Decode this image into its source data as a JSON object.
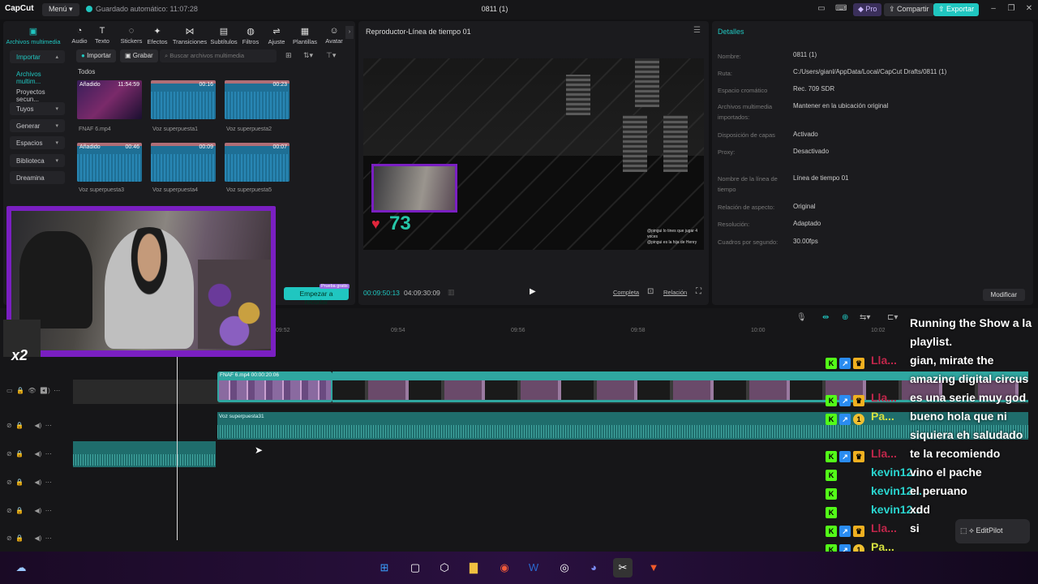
{
  "titlebar": {
    "logo": "CapCut",
    "menu": "Menú",
    "autosave": "Guardado automático: 11:07:28",
    "project": "0811 (1)",
    "pro": "Pro",
    "share": "Compartir",
    "export": "Exportar"
  },
  "tools": [
    {
      "label": "Archivos multimedia",
      "icon": "media-icon"
    },
    {
      "label": "Audio",
      "icon": "audio-icon"
    },
    {
      "label": "Texto",
      "icon": "text-icon"
    },
    {
      "label": "Stickers",
      "icon": "sticker-icon"
    },
    {
      "label": "Efectos",
      "icon": "effects-icon"
    },
    {
      "label": "Transiciones",
      "icon": "transitions-icon"
    },
    {
      "label": "Subtítulos",
      "icon": "subtitles-icon"
    },
    {
      "label": "Filtros",
      "icon": "filters-icon"
    },
    {
      "label": "Ajuste",
      "icon": "adjust-icon"
    },
    {
      "label": "Plantillas",
      "icon": "templates-icon"
    },
    {
      "label": "Avatar",
      "icon": "avatar-icon"
    }
  ],
  "sidebar": {
    "import": "Importar",
    "items": [
      "Archivos multim...",
      "Proyectos secun...",
      "Tuyos",
      "Generar",
      "Espacios",
      "Biblioteca",
      "Dreamina"
    ]
  },
  "media": {
    "import_btn": "Importar",
    "record_btn": "Grabar",
    "search_placeholder": "Buscar archivos multimedia",
    "section": "Todos",
    "items": [
      {
        "name": "FNAF 6.mp4",
        "dur": "11:54:59",
        "badge": "Añadido"
      },
      {
        "name": "Voz superpuesta1",
        "dur": "00:16",
        "badge": ""
      },
      {
        "name": "Voz superpuesta2",
        "dur": "00:23",
        "badge": ""
      },
      {
        "name": "Voz superpuesta3",
        "dur": "00:46",
        "badge": "Añadido"
      },
      {
        "name": "Voz superpuesta4",
        "dur": "00:09",
        "badge": ""
      },
      {
        "name": "Voz superpuesta5",
        "dur": "00:07",
        "badge": ""
      }
    ],
    "start_crop": "Empezar a recortar",
    "start_tag": "Prueba gratis"
  },
  "webcam": {
    "multiplier": "x2"
  },
  "player": {
    "title": "Reproductor-Línea de tiempo 01",
    "hp": "73",
    "mini_chat": [
      "@pingui lo tines que jugar 4",
      "voces",
      "@pingui es la hija de Henry"
    ],
    "current_time": "00:09:50:13",
    "total_time": "04:09:30:09",
    "complete": "Completa",
    "ratio": "Relación"
  },
  "details": {
    "title": "Detalles",
    "rows": [
      {
        "k": "Nombre:",
        "v": "0811 (1)"
      },
      {
        "k": "Ruta:",
        "v": "C:/Users/gianl/AppData/Local/CapCut Drafts/0811 (1)"
      },
      {
        "k": "Espacio cromático",
        "v": "Rec. 709 SDR"
      },
      {
        "k": "Archivos multimedia importados:",
        "v": "Mantener en la ubicación original"
      },
      {
        "k": "Disposición de capas",
        "v": "Activado"
      },
      {
        "k": "Proxy:",
        "v": "Desactivado"
      },
      {
        "k": "Nombre de la línea de tiempo",
        "v": "Línea de tiempo 01"
      },
      {
        "k": "Relación de aspecto:",
        "v": "Original"
      },
      {
        "k": "Resolución:",
        "v": "Adaptado"
      },
      {
        "k": "Cuadros por segundo:",
        "v": "30.00fps"
      }
    ],
    "modify": "Modificar"
  },
  "timeline": {
    "ruler": [
      "09:52",
      "09:54",
      "09:56",
      "09:58",
      "10:00",
      "10:02"
    ],
    "clip_game": "FNAF 6.mp4  00:00:20:06",
    "audio_clip": "Voz superpuesta31"
  },
  "chat": [
    {
      "user": "",
      "msg": "Running the Show a la",
      "badges": "",
      "color": "#ffffff"
    },
    {
      "user": "",
      "msg": "playlist.",
      "badges": "",
      "color": "#ffffff"
    },
    {
      "user": "Lla...",
      "msg": "gian, mirate the",
      "badges": "ksc",
      "color": "#c0264a"
    },
    {
      "user": "",
      "msg": "amazing digital circus",
      "badges": "",
      "color": "#ffffff"
    },
    {
      "user": "Lla...",
      "msg": "es una serie muy god",
      "badges": "ksc",
      "color": "#c0264a"
    },
    {
      "user": "Pa...",
      "msg": "bueno hola que ni",
      "badges": "ks1",
      "color": "#d6e040"
    },
    {
      "user": "",
      "msg": "siquiera eh saludado",
      "badges": "",
      "color": "#ffffff"
    },
    {
      "user": "Lla...",
      "msg": "te la recomiendo",
      "badges": "ksc",
      "color": "#c0264a"
    },
    {
      "user": "kevin12...",
      "msg": "vino el pache",
      "badges": "k",
      "color": "#2ad6d0"
    },
    {
      "user": "kevin12...",
      "msg": "el peruano",
      "badges": "k",
      "color": "#2ad6d0"
    },
    {
      "user": "kevin12...",
      "msg": "xdd",
      "badges": "k",
      "color": "#2ad6d0"
    },
    {
      "user": "Lla...",
      "msg": "si",
      "badges": "ksc",
      "color": "#c0264a"
    },
    {
      "user": "Pa...",
      "msg": "",
      "badges": "ks1",
      "color": "#d6e040"
    },
    {
      "user": "Pa...",
      "msg": "",
      "badges": "ks1",
      "color": "#d6e040"
    }
  ],
  "editpilot": "EditPilot"
}
